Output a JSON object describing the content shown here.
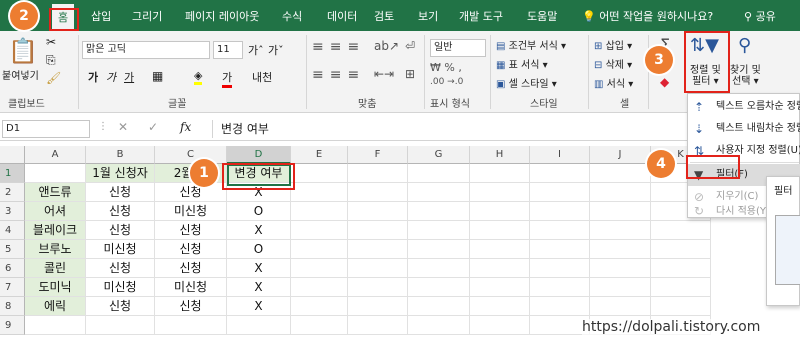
{
  "tabs": {
    "file": "",
    "home": "홈",
    "insert": "삽입",
    "draw": "그리기",
    "layout": "페이지 레이아웃",
    "formulas": "수식",
    "data": "데이터",
    "review": "검토",
    "view": "보기",
    "developer": "개발 도구",
    "help": "도움말",
    "tell_me": "어떤 작업을 원하시나요?",
    "share": "공유"
  },
  "ribbon": {
    "paste_label": "붙여넣기",
    "clipboard_group": "클립보드",
    "font_name": "맑은 고딕",
    "font_size": "11",
    "font_group": "글꼴",
    "alignment_group": "맞춤",
    "number_format": "일반",
    "number_group": "표시 형식",
    "conditional_format": "조건부 서식",
    "format_as_table": "표 서식",
    "cell_styles": "셀 스타일",
    "style_group": "스타일",
    "insert": "삽입",
    "delete": "삭제",
    "format": "서식",
    "cells_group": "셀",
    "sort_filter_line1": "정렬 및",
    "sort_filter_line2": "필터",
    "find_select_line1": "찾기 및",
    "find_select_line2": "선택"
  },
  "formula_bar": {
    "name_box": "D1",
    "fx": "fx",
    "content": "변경 여부"
  },
  "columns": [
    "A",
    "B",
    "C",
    "D",
    "E",
    "F",
    "G",
    "H",
    "I",
    "J",
    "K"
  ],
  "rows": [
    "1",
    "2",
    "3",
    "4",
    "5",
    "6",
    "7",
    "8",
    "9"
  ],
  "cells": {
    "B1": "1월 신청자",
    "C1": "2월 신",
    "D1": "변경 여부",
    "A": [
      "앤드류",
      "어셔",
      "블레이크",
      "브루노",
      "콜린",
      "도미닉",
      "에릭"
    ],
    "B": [
      "신청",
      "신청",
      "신청",
      "미신청",
      "신청",
      "미신청",
      "신청"
    ],
    "C": [
      "신청",
      "미신청",
      "신청",
      "신청",
      "신청",
      "미신청",
      "신청"
    ],
    "D": [
      "X",
      "O",
      "X",
      "O",
      "X",
      "X",
      "X"
    ]
  },
  "sort_menu": {
    "sort_asc": "텍스트 오름차순 정렬",
    "sort_desc": "텍스트 내림차순 정렬",
    "custom_sort": "사용자 지정 정렬(U)",
    "filter": "필터(F)",
    "clear": "지우기(C)",
    "reapply": "다시 적용(Y)"
  },
  "side_panel": {
    "title": "필터"
  },
  "badges": [
    "1",
    "2",
    "3",
    "4"
  ],
  "watermark": "https://dolpali.tistory.com",
  "colors": {
    "excel_green": "#217346",
    "highlight_green": "#e2efda",
    "badge_orange": "#ed7d31",
    "callout_red": "#e2231a"
  }
}
